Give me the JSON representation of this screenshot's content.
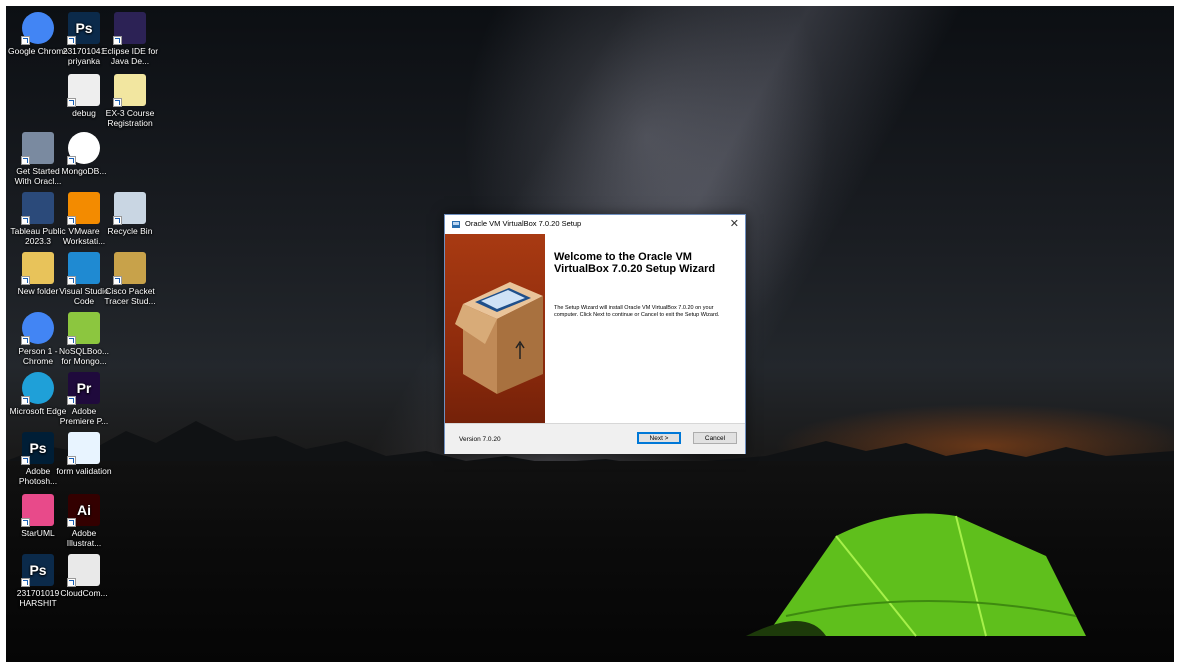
{
  "desktop": {
    "icons": [
      {
        "label": "Google Chrome",
        "icon": "chrome-icon",
        "color": "#4285f4",
        "text": ""
      },
      {
        "label": "231701041 priyanka",
        "icon": "photoshop-psd-icon",
        "color": "#0b2a4a",
        "text": "Ps"
      },
      {
        "label": "Eclipse IDE for Java De...",
        "icon": "eclipse-icon",
        "color": "#2c2255",
        "text": ""
      },
      {
        "label": "debug",
        "icon": "text-file-icon",
        "color": "#eeeeee",
        "text": ""
      },
      {
        "label": "EX-3 Course Registration",
        "icon": "file-icon",
        "color": "#f2e6a0",
        "text": ""
      },
      {
        "label": "Get Started With Oracl...",
        "icon": "oracle-db-icon",
        "color": "#7a8aa0",
        "text": ""
      },
      {
        "label": "MongoDB...",
        "icon": "mongodb-icon",
        "color": "#ffffff",
        "text": ""
      },
      {
        "label": "Tableau Public 2023.3",
        "icon": "tableau-icon",
        "color": "#2b4a7a",
        "text": ""
      },
      {
        "label": "VMware Workstati...",
        "icon": "vmware-icon",
        "color": "#f38b00",
        "text": ""
      },
      {
        "label": "Recycle Bin",
        "icon": "recycle-bin-icon",
        "color": "#c9d6e3",
        "text": ""
      },
      {
        "label": "New folder",
        "icon": "folder-icon",
        "color": "#e8c35a",
        "text": ""
      },
      {
        "label": "Visual Studio Code",
        "icon": "vscode-icon",
        "color": "#1f8ad2",
        "text": ""
      },
      {
        "label": "Cisco Packet Tracer Stud...",
        "icon": "cisco-packet-tracer-icon",
        "color": "#c8a24a",
        "text": ""
      },
      {
        "label": "Person 1 - Chrome",
        "icon": "chrome-profile-icon",
        "color": "#4285f4",
        "text": ""
      },
      {
        "label": "NoSQLBoo... for Mongo...",
        "icon": "nosqlbooster-icon",
        "color": "#8cc63f",
        "text": ""
      },
      {
        "label": "Microsoft Edge",
        "icon": "edge-icon",
        "color": "#1fa0d8",
        "text": ""
      },
      {
        "label": "Adobe Premiere P...",
        "icon": "premiere-icon",
        "color": "#1f0a3c",
        "text": "Pr"
      },
      {
        "label": "Adobe Photosh...",
        "icon": "photoshop-icon",
        "color": "#001e36",
        "text": "Ps"
      },
      {
        "label": "form validation",
        "icon": "html-file-icon",
        "color": "#e8f4ff",
        "text": ""
      },
      {
        "label": "StarUML",
        "icon": "staruml-icon",
        "color": "#e84a8a",
        "text": ""
      },
      {
        "label": "Adobe Illustrat...",
        "icon": "illustrator-icon",
        "color": "#330000",
        "text": "Ai"
      },
      {
        "label": "231701019 HARSHIT",
        "icon": "photoshop-psd-icon",
        "color": "#0b2a4a",
        "text": "Ps"
      },
      {
        "label": "CloudCom...",
        "icon": "document-icon",
        "color": "#e9e9e9",
        "text": ""
      }
    ]
  },
  "dialog": {
    "title": "Oracle VM VirtualBox 7.0.20 Setup",
    "heading": "Welcome to the Oracle VM VirtualBox 7.0.20 Setup Wizard",
    "description": "The Setup Wizard will install Oracle VM VirtualBox 7.0.20 on your computer. Click Next to continue or Cancel to exit the Setup Wizard.",
    "version": "Version 7.0.20",
    "next_label": "Next >",
    "cancel_label": "Cancel",
    "close_glyph": "✕"
  },
  "colors": {
    "dialog_border": "#6f8fbf",
    "banner": "#a83a12",
    "primary_button_border": "#0078d7"
  }
}
